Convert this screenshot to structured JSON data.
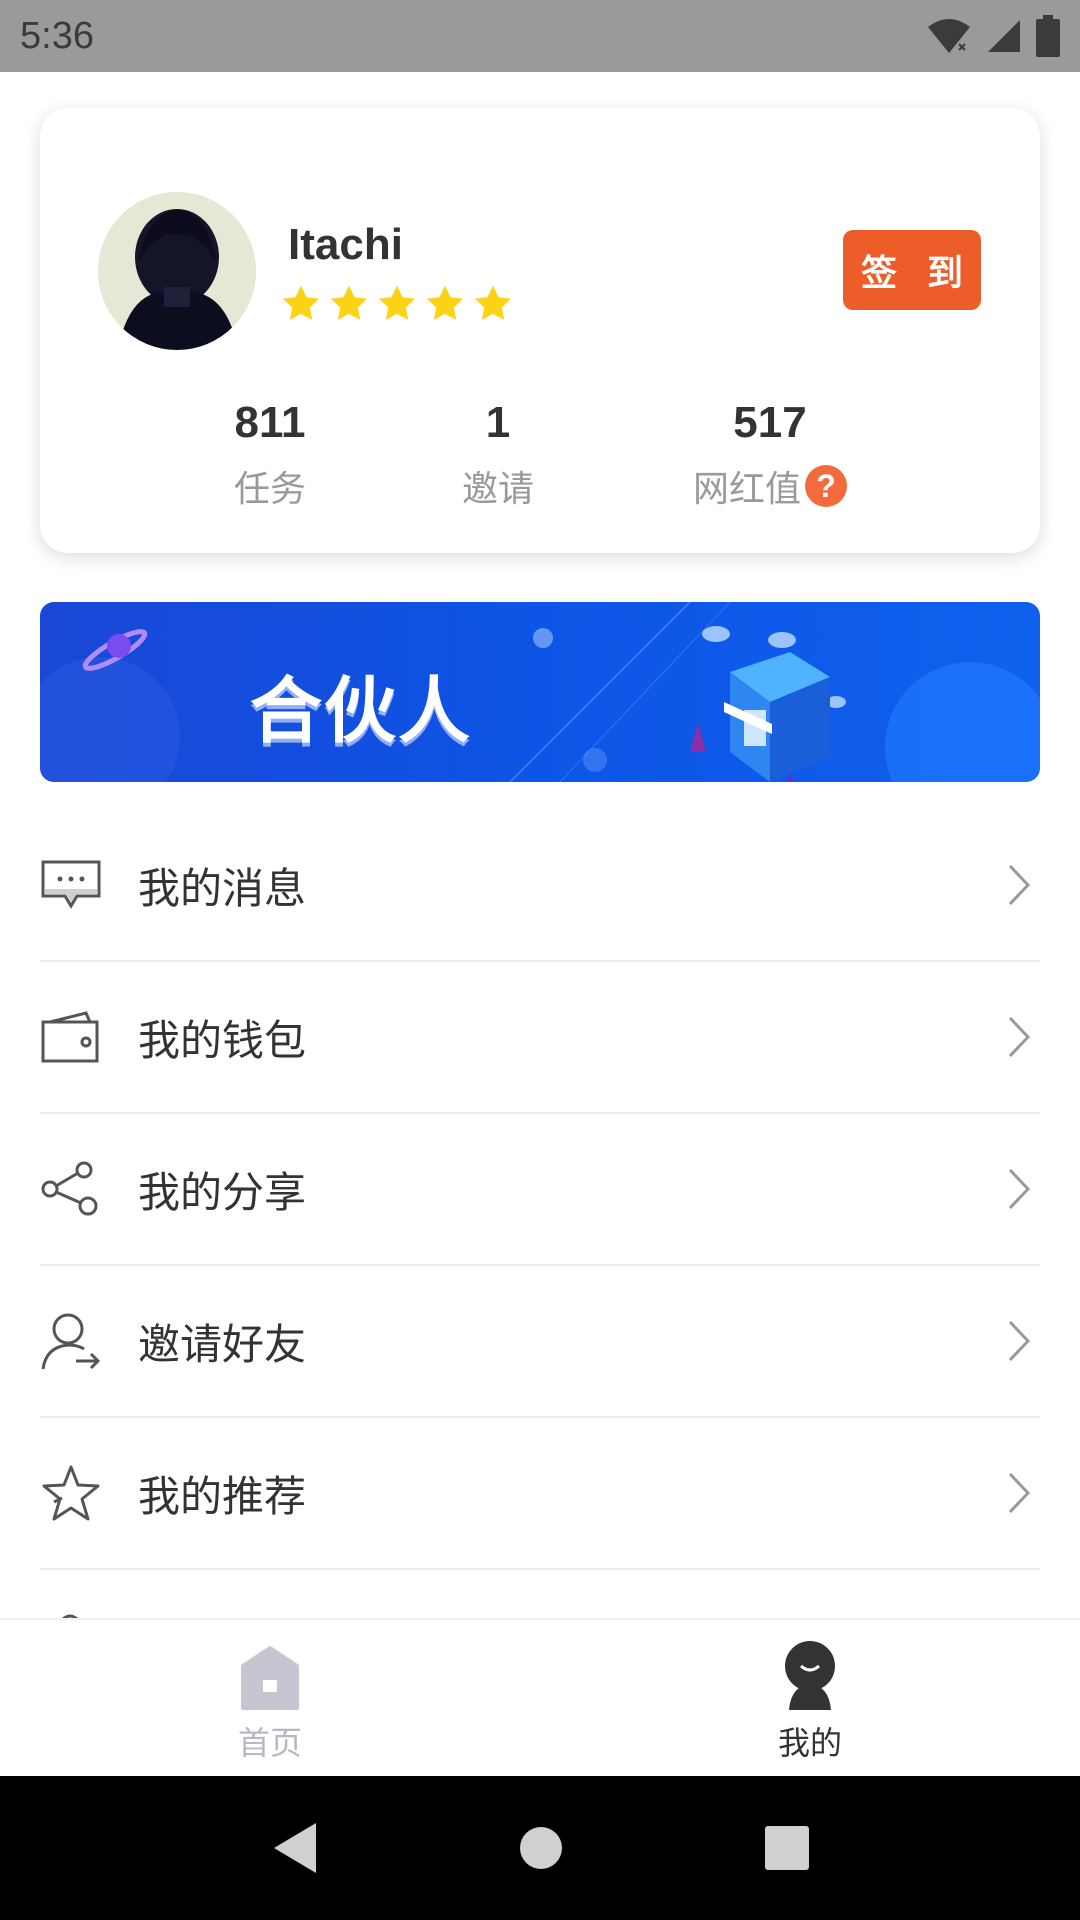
{
  "status_bar": {
    "time": "5:36"
  },
  "profile": {
    "username": "Itachi",
    "rating_stars": 5,
    "checkin_label": "签 到",
    "stats": [
      {
        "value": "811",
        "label": "任务"
      },
      {
        "value": "1",
        "label": "邀请"
      },
      {
        "value": "517",
        "label": "网红值"
      }
    ],
    "help_glyph": "?"
  },
  "banner": {
    "title": "合伙人"
  },
  "menu": {
    "items": [
      {
        "label": "我的消息",
        "icon": "message-icon"
      },
      {
        "label": "我的钱包",
        "icon": "wallet-icon"
      },
      {
        "label": "我的分享",
        "icon": "share-icon"
      },
      {
        "label": "邀请好友",
        "icon": "invite-friend-icon"
      },
      {
        "label": "我的推荐",
        "icon": "star-outline-icon"
      }
    ]
  },
  "bottom_nav": {
    "items": [
      {
        "label": "首页",
        "icon": "home-icon",
        "active": false
      },
      {
        "label": "我的",
        "icon": "profile-icon",
        "active": true
      }
    ]
  },
  "colors": {
    "accent": "#ed5d2a",
    "star": "#fdd116",
    "banner": "#0d55e6",
    "nav_inactive": "#b8b8c4"
  }
}
